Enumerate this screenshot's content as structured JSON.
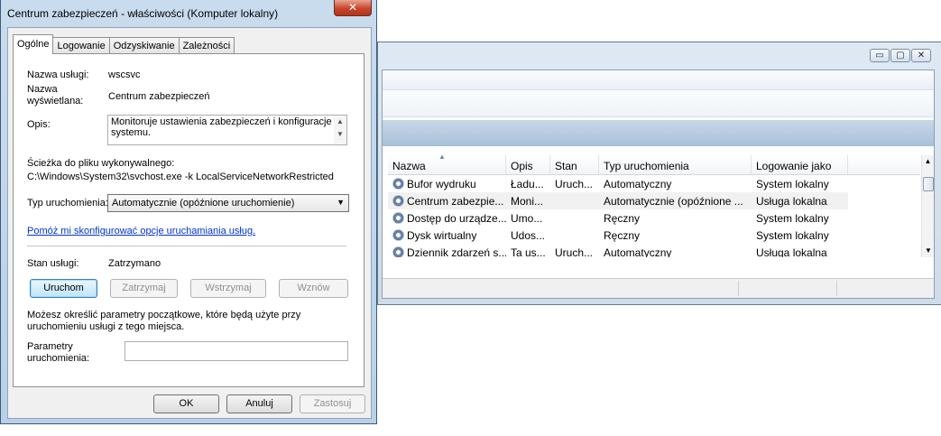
{
  "dialog": {
    "title": "Centrum zabezpieczeń - właściwości (Komputer lokalny)",
    "close_glyph": "✕",
    "tabs": [
      "Ogólne",
      "Logowanie",
      "Odzyskiwanie",
      "Zależności"
    ],
    "active_tab": "Ogólne",
    "service_name_label": "Nazwa usługi:",
    "service_name_value": "wscsvc",
    "display_name_label_1": "Nazwa",
    "display_name_label_2": "wyświetlana:",
    "display_name_value": "Centrum zabezpieczeń",
    "description_label": "Opis:",
    "description_value": "Monitoruje ustawienia zabezpieczeń i konfiguracje systemu.",
    "path_label": "Ścieżka do pliku wykonywalnego:",
    "path_value": "C:\\Windows\\System32\\svchost.exe -k LocalServiceNetworkRestricted",
    "startup_type_label": "Typ uruchomienia:",
    "startup_type_value": "Automatycznie (opóźnione uruchomienie)",
    "help_link": "Pomóż mi skonfigurować opcje uruchamiania usług.",
    "status_label": "Stan usługi:",
    "status_value": "Zatrzymano",
    "start_button": "Uruchom",
    "stop_button": "Zatrzymaj",
    "pause_button": "Wstrzymaj",
    "resume_button": "Wznów",
    "params_hint": "Możesz określić parametry początkowe, które będą użyte przy uruchomieniu usługi z tego miejsca.",
    "params_label_1": "Parametry",
    "params_label_2": "uruchomienia:",
    "params_value": "",
    "ok_button": "OK",
    "cancel_button": "Anuluj",
    "apply_button": "Zastosuj"
  },
  "services": {
    "caption_buttons": [
      "▭",
      "▢",
      "✕"
    ],
    "columns": [
      "Nazwa",
      "Opis",
      "Stan",
      "Typ uruchomienia",
      "Logowanie jako"
    ],
    "rows": [
      {
        "name": "Bufor wydruku",
        "desc": "Ładu...",
        "state": "Uruch...",
        "startup": "Automatyczny",
        "logon": "System lokalny"
      },
      {
        "name": "Centrum zabezpie...",
        "desc": "Moni...",
        "state": "",
        "startup": "Automatycznie (opóźnione ...",
        "logon": "Usługa lokalna"
      },
      {
        "name": "Dostęp do urządze...",
        "desc": "Umo...",
        "state": "",
        "startup": "Ręczny",
        "logon": "System lokalny"
      },
      {
        "name": "Dysk wirtualny",
        "desc": "Udos...",
        "state": "",
        "startup": "Ręczny",
        "logon": "System lokalny"
      },
      {
        "name": "Dziennik zdarzeń s...",
        "desc": "Ta us...",
        "state": "Uruch...",
        "startup": "Automatyczny",
        "logon": "Usługa lokalna"
      }
    ]
  }
}
